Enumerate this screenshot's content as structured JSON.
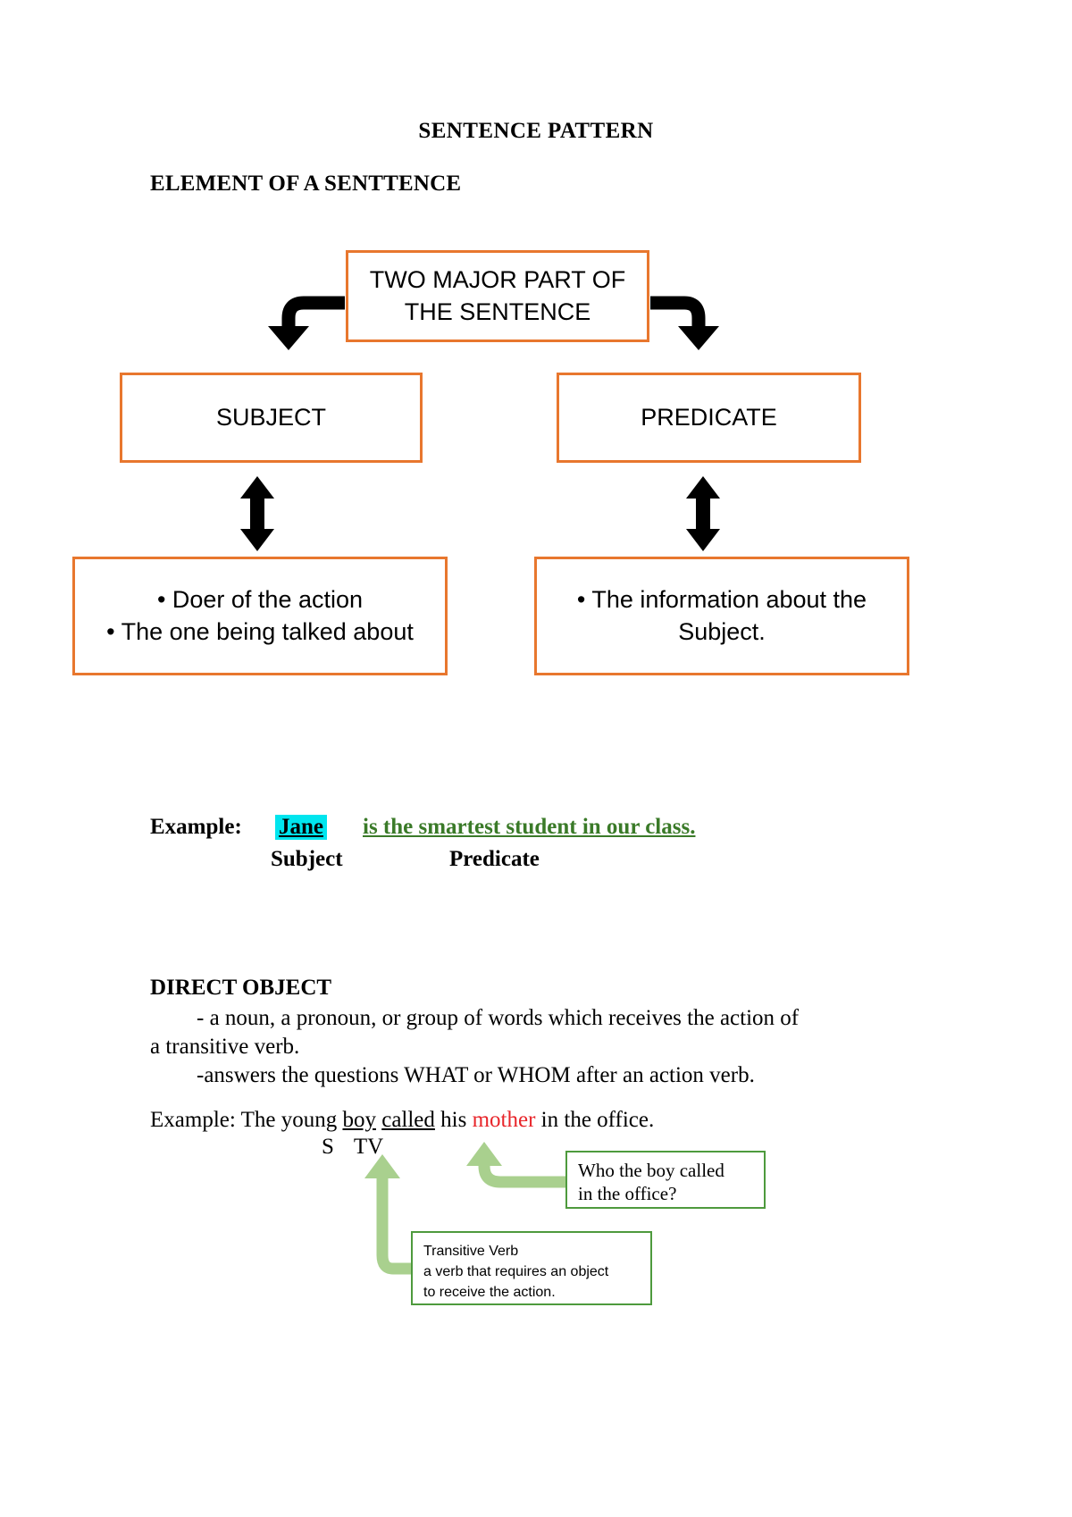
{
  "document": {
    "title": "SENTENCE PATTERN",
    "section_heading": "ELEMENT OF A SENTTENCE"
  },
  "colors": {
    "box_border_orange": "#E8772E",
    "arrow_black": "#000000",
    "callout_border_green": "#4E9A3D",
    "callout_arrow_green": "#A9D08E",
    "highlight_cyan": "#00E5EE",
    "predicate_green": "#3A7A28",
    "direct_object_red": "#E8252A"
  },
  "flowchart": {
    "top_box": {
      "line1": "TWO MAJOR PART OF",
      "line2": "THE SENTENCE"
    },
    "subject_box": "SUBJECT",
    "predicate_box": "PREDICATE",
    "subject_desc": {
      "line1": "• Doer of the action",
      "line2": "• The one being talked about"
    },
    "predicate_desc": {
      "line1": "• The information about the",
      "line2": "Subject."
    }
  },
  "example_sentence": {
    "label": "Example:",
    "subject": "Jane",
    "predicate": "is the smartest student in our class.",
    "subject_tag": "Subject",
    "predicate_tag": "Predicate"
  },
  "direct_object": {
    "heading": "DIRECT OBJECT",
    "definition_line1": "- a noun, a pronoun, or group of words which receives the action of",
    "definition_line2": "a transitive verb.",
    "definition_line3": "-answers the questions WHAT or WHOM after an action verb.",
    "example": {
      "prefix": "Example: The young ",
      "subject": "boy",
      "space1": " ",
      "verb": "called",
      "middle": " his ",
      "object": "mother",
      "suffix": " in the office."
    },
    "labels": {
      "s": "S",
      "tv": "TV"
    },
    "callout_question": {
      "line1": "Who the boy called",
      "line2": "in the office?"
    },
    "callout_transitive_verb": {
      "line1": "Transitive Verb",
      "line2": "a verb that requires an object",
      "line3": "to receive the action."
    }
  }
}
